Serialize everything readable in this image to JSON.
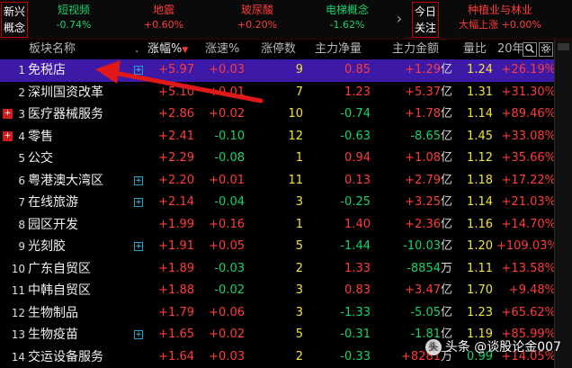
{
  "topbar": {
    "left_tab": "新兴概念",
    "right_tab": "今日关注",
    "concepts": [
      {
        "name": "短视频",
        "change": "-0.74%",
        "tone": "green"
      },
      {
        "name": "地震",
        "change": "+0.60%",
        "tone": "red"
      },
      {
        "name": "玻尿酸",
        "change": "+0.20%",
        "tone": "red"
      },
      {
        "name": "电梯概念",
        "change": "-1.62%",
        "tone": "green"
      },
      {
        "name": "种植业与林业",
        "change": "大幅上涨 +0.00%",
        "tone": "red"
      }
    ],
    "nav_right": "›"
  },
  "header": {
    "name": "板块名称",
    "dot": ".",
    "change": "涨幅%",
    "change_sort": "▼",
    "speed": "涨速%",
    "limit_up": "涨停数",
    "net_inflow": "主力净量",
    "main_amount": "主力金额",
    "vol_ratio": "量比",
    "year": "20年",
    "search_icon": "search-icon",
    "settings_icon": "gear-icon"
  },
  "rows": [
    {
      "idx": "1",
      "name": "免税店",
      "flag": "",
      "plus": true,
      "change": "+5.97",
      "speed": "+0.03",
      "limit_up": "9",
      "net": "0.85",
      "amount": "+1.29",
      "unit": "亿",
      "ratio": "1.24",
      "year": "+26.19%",
      "tones": [
        "red",
        "red",
        "yellow",
        "red",
        "red",
        "yellow",
        "red"
      ]
    },
    {
      "idx": "2",
      "name": "深圳国资改革",
      "flag": "",
      "plus": false,
      "change": "+5.10",
      "speed": "+0.01",
      "limit_up": "7",
      "net": "1.23",
      "amount": "+5.37",
      "unit": "亿",
      "ratio": "1.31",
      "year": "+31.30%",
      "tones": [
        "red",
        "red",
        "yellow",
        "red",
        "red",
        "yellow",
        "red"
      ]
    },
    {
      "idx": "3",
      "name": "医疗器械服务",
      "flag": "+",
      "plus": false,
      "change": "+2.86",
      "speed": "+0.02",
      "limit_up": "10",
      "net": "-0.74",
      "amount": "+1.78",
      "unit": "亿",
      "ratio": "1.14",
      "year": "+89.46%",
      "tones": [
        "red",
        "red",
        "yellow",
        "green",
        "red",
        "yellow",
        "red"
      ]
    },
    {
      "idx": "4",
      "name": "零售",
      "flag": "+",
      "plus": false,
      "change": "+2.41",
      "speed": "-0.10",
      "limit_up": "12",
      "net": "-0.63",
      "amount": "-8.65",
      "unit": "亿",
      "ratio": "1.45",
      "year": "+33.08%",
      "tones": [
        "red",
        "green",
        "yellow",
        "green",
        "green",
        "yellow",
        "red"
      ]
    },
    {
      "idx": "5",
      "name": "公交",
      "flag": "",
      "plus": false,
      "change": "+2.29",
      "speed": "-0.08",
      "limit_up": "1",
      "net": "0.94",
      "amount": "+1.08",
      "unit": "亿",
      "ratio": "1.12",
      "year": "+35.66%",
      "tones": [
        "red",
        "green",
        "yellow",
        "red",
        "red",
        "yellow",
        "red"
      ]
    },
    {
      "idx": "6",
      "name": "粤港澳大湾区",
      "flag": "",
      "plus": true,
      "change": "+2.20",
      "speed": "+0.01",
      "limit_up": "11",
      "net": "0.13",
      "amount": "+2.79",
      "unit": "亿",
      "ratio": "1.18",
      "year": "+17.22%",
      "tones": [
        "red",
        "red",
        "yellow",
        "red",
        "red",
        "yellow",
        "red"
      ]
    },
    {
      "idx": "7",
      "name": "在线旅游",
      "flag": "",
      "plus": true,
      "change": "+2.14",
      "speed": "-0.04",
      "limit_up": "3",
      "net": "-0.25",
      "amount": "+3.25",
      "unit": "亿",
      "ratio": "1.14",
      "year": "+21.03%",
      "tones": [
        "red",
        "green",
        "yellow",
        "green",
        "red",
        "yellow",
        "red"
      ]
    },
    {
      "idx": "8",
      "name": "园区开发",
      "flag": "",
      "plus": false,
      "change": "+1.99",
      "speed": "+0.16",
      "limit_up": "1",
      "net": "1.40",
      "amount": "+2.36",
      "unit": "亿",
      "ratio": "1.16",
      "year": "+14.70%",
      "tones": [
        "red",
        "red",
        "yellow",
        "red",
        "red",
        "yellow",
        "red"
      ]
    },
    {
      "idx": "9",
      "name": "光刻胶",
      "flag": "",
      "plus": true,
      "change": "+1.91",
      "speed": "+0.05",
      "limit_up": "5",
      "net": "-1.44",
      "amount": "-10.03",
      "unit": "亿",
      "ratio": "1.20",
      "year": "+109.03%",
      "tones": [
        "red",
        "red",
        "yellow",
        "green",
        "green",
        "yellow",
        "red"
      ]
    },
    {
      "idx": "10",
      "name": "广东自贸区",
      "flag": "",
      "plus": false,
      "change": "+1.89",
      "speed": "-0.03",
      "limit_up": "2",
      "net": "1.33",
      "amount": "-8854",
      "unit": "万",
      "ratio": "1.11",
      "year": "+13.58%",
      "tones": [
        "red",
        "green",
        "yellow",
        "red",
        "green",
        "yellow",
        "red"
      ]
    },
    {
      "idx": "11",
      "name": "中韩自贸区",
      "flag": "",
      "plus": false,
      "change": "+1.88",
      "speed": "-0.02",
      "limit_up": "3",
      "net": "0.83",
      "amount": "+3.47",
      "unit": "亿",
      "ratio": "1.70",
      "year": "+9.48%",
      "tones": [
        "red",
        "green",
        "yellow",
        "red",
        "red",
        "yellow",
        "red"
      ]
    },
    {
      "idx": "12",
      "name": "生物制品",
      "flag": "",
      "plus": false,
      "change": "+1.79",
      "speed": "+0.06",
      "limit_up": "3",
      "net": "-1.33",
      "amount": "-5.05",
      "unit": "亿",
      "ratio": "1.23",
      "year": "+65.62%",
      "tones": [
        "red",
        "red",
        "yellow",
        "green",
        "green",
        "yellow",
        "red"
      ]
    },
    {
      "idx": "13",
      "name": "生物疫苗",
      "flag": "",
      "plus": true,
      "change": "+1.65",
      "speed": "+0.02",
      "limit_up": "5",
      "net": "-0.31",
      "amount": "-1.81",
      "unit": "亿",
      "ratio": "1.19",
      "year": "+85.99%",
      "tones": [
        "red",
        "red",
        "yellow",
        "green",
        "green",
        "yellow",
        "red"
      ]
    },
    {
      "idx": "14",
      "name": "交运设备服务",
      "flag": "",
      "plus": false,
      "change": "+1.64",
      "speed": "+0.03",
      "limit_up": "2",
      "net": "-0.33",
      "amount": "+8281",
      "unit": "万",
      "ratio": "0.99",
      "year": "+14.05%",
      "tones": [
        "red",
        "red",
        "yellow",
        "green",
        "red",
        "green",
        "red"
      ]
    }
  ],
  "selected_row": 0,
  "colors": {
    "selected": "#3c19a6",
    "up": "#ff3b3b",
    "down": "#15d26a",
    "neutral": "#f2e23a",
    "arrow": "#e01818"
  },
  "watermark": {
    "text": "头条 @谈股论金007",
    "badge": "头"
  }
}
